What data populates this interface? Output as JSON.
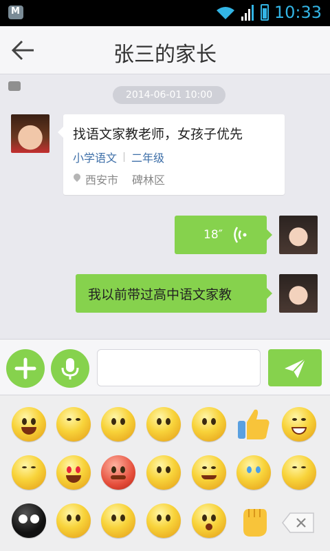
{
  "status_bar": {
    "time": "10:33",
    "left_icons": [
      "m-notification-icon",
      "chat-notification-icon"
    ]
  },
  "header": {
    "title": "张三的家长"
  },
  "chat": {
    "timestamp": "2014-06-01  10:00",
    "request_card": {
      "title": "找语文家教老师，女孩子优先",
      "subject": "小学语文",
      "grade": "二年级",
      "city": "西安市",
      "district": "碑林区"
    },
    "voice_message": {
      "duration": "18″"
    },
    "text_message": "我以前带过高中语文家教"
  },
  "input_bar": {
    "text_value": ""
  },
  "colors": {
    "accent_green": "#86d24d",
    "link_blue": "#3e6fa8",
    "status_blue": "#33b5e5"
  },
  "emoji_panel": {
    "rows": [
      [
        "grin",
        "shy-pray",
        "worried",
        "confused-question",
        "dizzy",
        "thumbs-up",
        "big-grin"
      ],
      [
        "sleepy",
        "heart-eyes",
        "angry",
        "skeptical",
        "smile",
        "crying",
        "sweat"
      ],
      [
        "alien",
        "sealed-lips",
        "embarrassed",
        "astonished",
        "surprised",
        "fist",
        "backspace"
      ]
    ]
  }
}
